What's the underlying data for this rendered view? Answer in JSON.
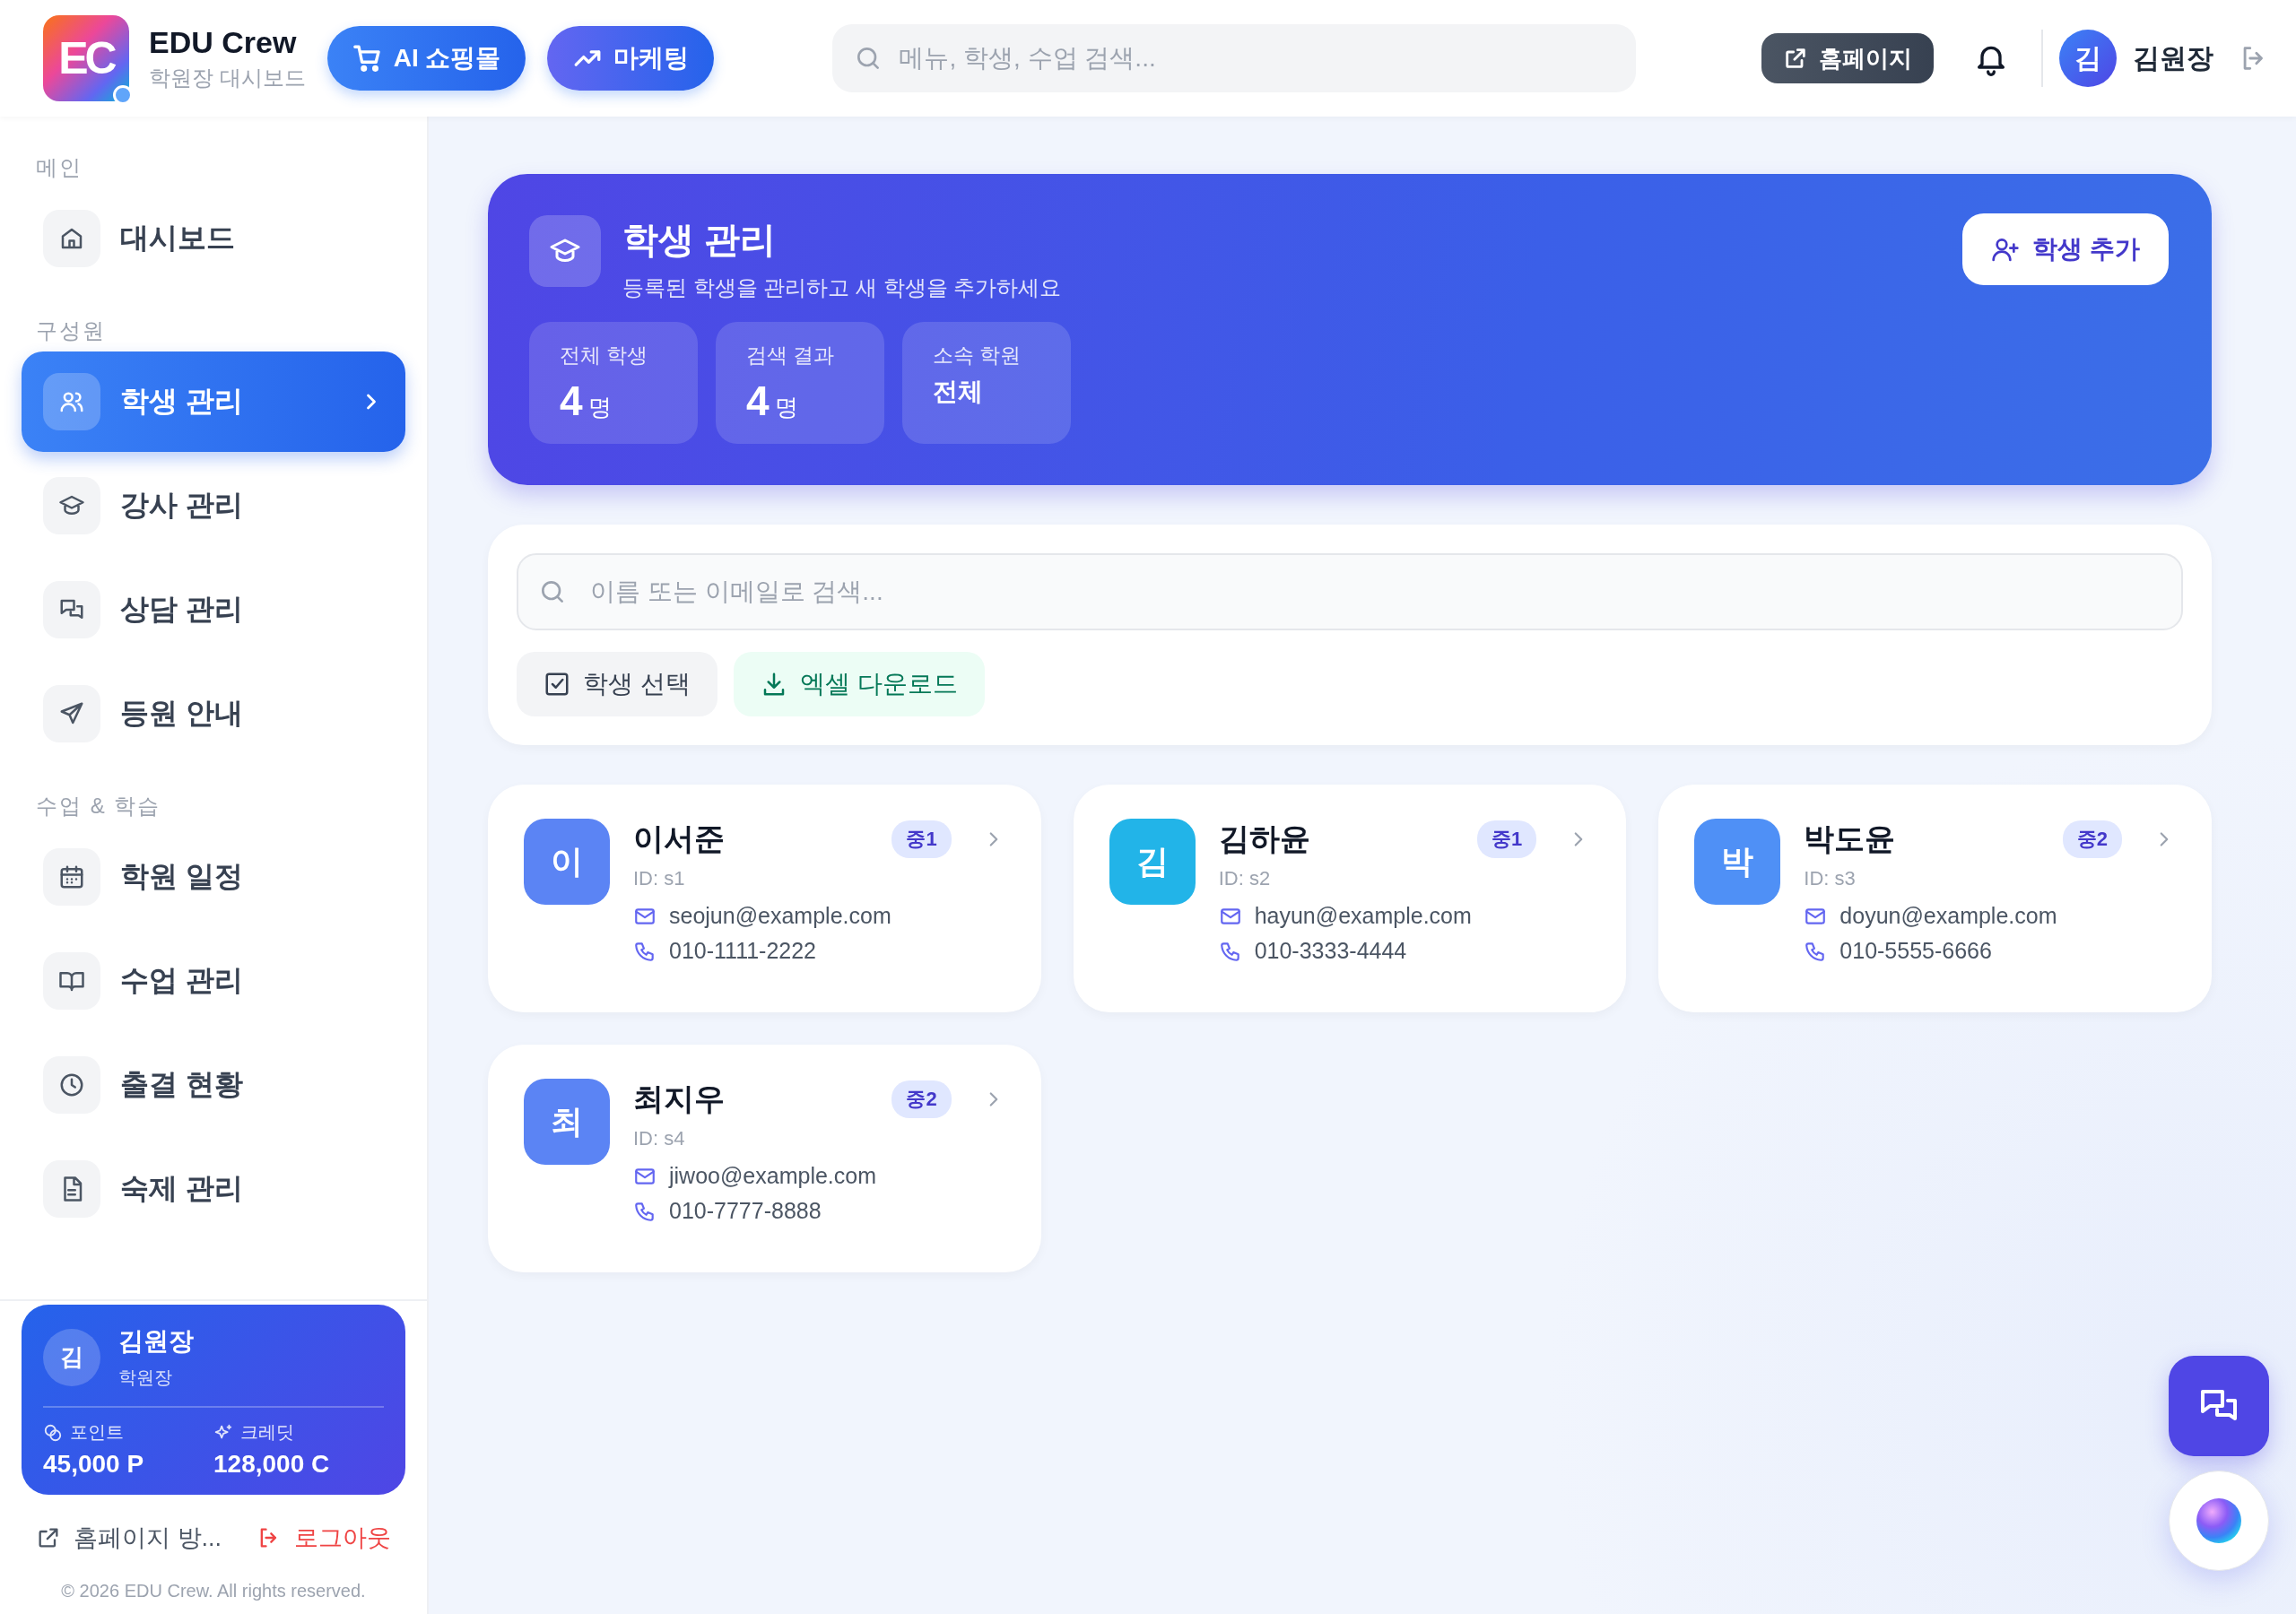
{
  "header": {
    "logo": "EC",
    "brand": "EDU Crew",
    "subtitle": "학원장 대시보드",
    "nav_buttons": [
      {
        "label": "AI 쇼핑몰"
      },
      {
        "label": "마케팅"
      }
    ],
    "search": {
      "placeholder": "메뉴, 학생, 수업 검색..."
    },
    "homepage_button": "홈페이지",
    "user": {
      "avatar": "김",
      "name": "김원장"
    }
  },
  "sidebar": {
    "sections": [
      {
        "label": "메인",
        "items": [
          {
            "label": "대시보드",
            "selected": false
          }
        ]
      },
      {
        "label": "구성원",
        "items": [
          {
            "label": "학생 관리",
            "selected": true
          },
          {
            "label": "강사 관리",
            "selected": false
          },
          {
            "label": "상담 관리",
            "selected": false
          },
          {
            "label": "등원 안내",
            "selected": false
          }
        ]
      },
      {
        "label": "수업 & 학습",
        "items": [
          {
            "label": "학원 일정",
            "selected": false
          },
          {
            "label": "수업 관리",
            "selected": false
          },
          {
            "label": "출결 현황",
            "selected": false
          },
          {
            "label": "숙제 관리",
            "selected": false
          }
        ]
      }
    ],
    "profile": {
      "avatar": "김",
      "name": "김원장",
      "role": "학원장",
      "stats": [
        {
          "label": "포인트",
          "value": "45,000 P"
        },
        {
          "label": "크레딧",
          "value": "128,000 C"
        }
      ]
    },
    "links": [
      {
        "label": "홈페이지 방...",
        "kind": "normal"
      },
      {
        "label": "로그아웃",
        "kind": "danger"
      }
    ],
    "copyright": "© 2026 EDU Crew. All rights reserved."
  },
  "banner": {
    "title": "학생 관리",
    "subtitle": "등록된 학생을 관리하고 새 학생을 추가하세요",
    "stats": [
      {
        "label": "전체 학생",
        "value": "4",
        "unit": "명"
      },
      {
        "label": "검색 결과",
        "value": "4",
        "unit": "명"
      },
      {
        "label": "소속 학원",
        "value": "전체"
      }
    ],
    "add_button": "학생 추가"
  },
  "filter": {
    "placeholder": "이름 또는 이메일로 검색...",
    "actions": [
      {
        "label": "학생 선택",
        "kind": "neutral"
      },
      {
        "label": "엑셀 다운로드",
        "kind": "success"
      }
    ]
  },
  "students": [
    {
      "initial": "이",
      "name": "이서준",
      "id": "ID: s1",
      "grade": "중1",
      "email": "seojun@example.com",
      "phone": "010-1111-2222",
      "color": "#5b84f4"
    },
    {
      "initial": "김",
      "name": "김하윤",
      "id": "ID: s2",
      "grade": "중1",
      "email": "hayun@example.com",
      "phone": "010-3333-4444",
      "color": "#22b4e8"
    },
    {
      "initial": "박",
      "name": "박도윤",
      "id": "ID: s3",
      "grade": "중2",
      "email": "doyun@example.com",
      "phone": "010-5555-6666",
      "color": "#4f90f6"
    },
    {
      "initial": "최",
      "name": "최지우",
      "id": "ID: s4",
      "grade": "중2",
      "email": "jiwoo@example.com",
      "phone": "010-7777-8888",
      "color": "#5b84f4"
    }
  ]
}
